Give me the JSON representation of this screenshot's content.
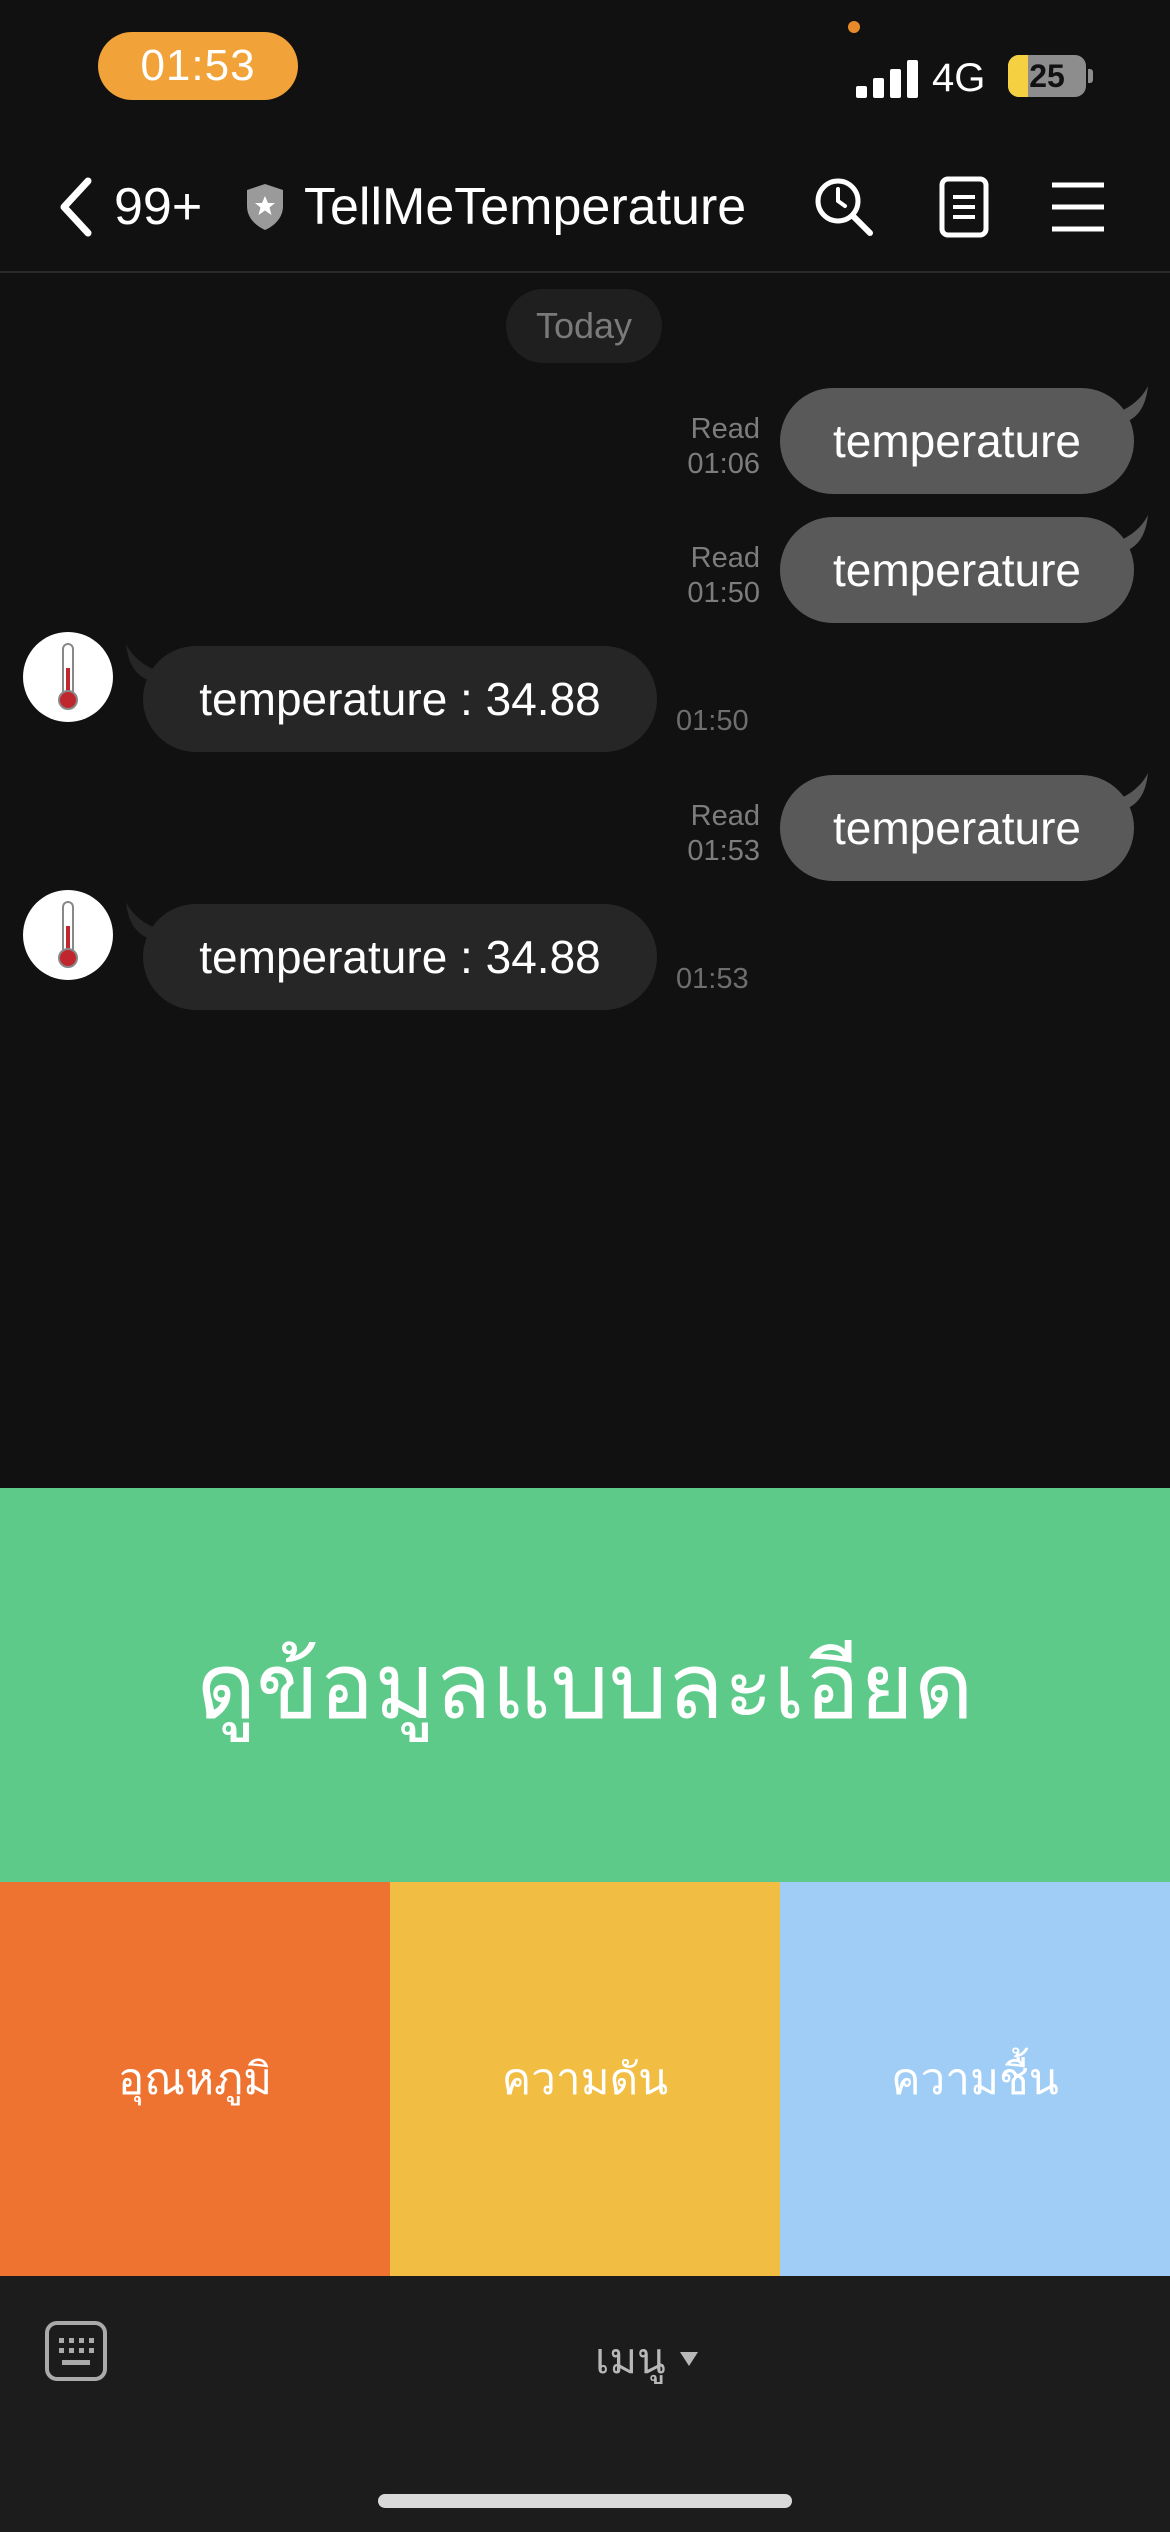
{
  "status_bar": {
    "time": "01:53",
    "network": "4G",
    "battery": "25",
    "battery_level": 0.25
  },
  "header": {
    "unread_count": "99+",
    "chat_title": "TellMeTemperature",
    "icons": [
      "chevron-left-icon",
      "shield-star-icon",
      "search-icon",
      "notes-icon",
      "hamburger-menu-icon"
    ]
  },
  "chat": {
    "date_label": "Today",
    "messages": [
      {
        "from": "me",
        "text": "temperature",
        "status": "Read",
        "time": "01:06"
      },
      {
        "from": "me",
        "text": "temperature",
        "status": "Read",
        "time": "01:50"
      },
      {
        "from": "bot",
        "text": "temperature : 34.88",
        "time": "01:50",
        "avatar": "thermometer-icon"
      },
      {
        "from": "me",
        "text": "temperature",
        "status": "Read",
        "time": "01:53"
      },
      {
        "from": "bot",
        "text": "temperature : 34.88",
        "time": "01:53",
        "avatar": "thermometer-icon"
      }
    ]
  },
  "rich_menu": {
    "top": {
      "label": "ดูข้อมูลแบบละเอียด",
      "color": "#5DCA8A"
    },
    "cells": [
      {
        "label": "อุณหภูมิ",
        "color": "#EE7230"
      },
      {
        "label": "ความดัน",
        "color": "#F1BD43"
      },
      {
        "label": "ความชื้น",
        "color": "#9FCDF5"
      }
    ]
  },
  "bottom_bar": {
    "menu_label": "เมนู",
    "icons": [
      "keyboard-icon",
      "triangle-down-icon"
    ]
  }
}
